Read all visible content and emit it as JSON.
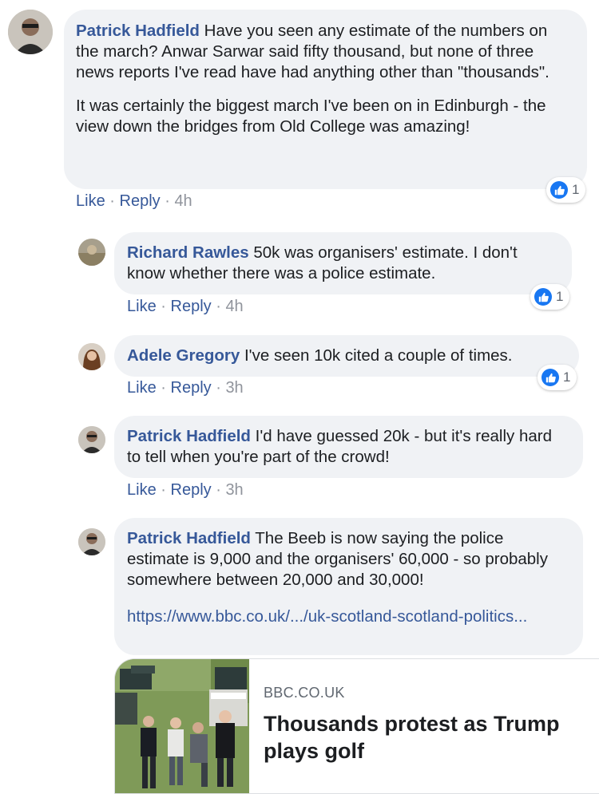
{
  "comments": [
    {
      "author": "Patrick Hadfield",
      "text": "Have you seen any estimate of the numbers on the march? Anwar Sarwar said fifty thousand, but none of three news reports I've read have had anything other than \"thousands\".",
      "text2": "It was certainly the biggest march I've been on in Edinburgh - the view down the bridges from Old College was amazing!",
      "like": "Like",
      "reply": "Reply",
      "sep": "·",
      "time": "4h",
      "reactions": "1"
    },
    {
      "author": "Richard Rawles",
      "text": "50k was organisers' estimate. I don't know whether there was a police estimate.",
      "like": "Like",
      "reply": "Reply",
      "sep": "·",
      "time": "4h",
      "reactions": "1"
    },
    {
      "author": "Adele Gregory",
      "text": "I've seen 10k cited a couple of times.",
      "like": "Like",
      "reply": "Reply",
      "sep": "·",
      "time": "3h",
      "reactions": "1"
    },
    {
      "author": "Patrick Hadfield",
      "text": "I'd have guessed 20k - but it's really hard to tell when you're part of the crowd!",
      "like": "Like",
      "reply": "Reply",
      "sep": "·",
      "time": "3h"
    },
    {
      "author": "Patrick Hadfield",
      "text": "The Beeb is now saying the police estimate is 9,000 and the organisers' 60,000 - so probably somewhere between 20,000 and 30,000!",
      "link": "https://www.bbc.co.uk/.../uk-scotland-scotland-politics..."
    }
  ],
  "preview": {
    "domain": "BBC.CO.UK",
    "headline": "Thousands protest as Trump plays golf"
  },
  "colors": {
    "author": "#365899",
    "bubble": "#f0f2f5",
    "like_blue": "#1877f2"
  },
  "icons": [
    "avatar",
    "thumbs-up-icon"
  ]
}
